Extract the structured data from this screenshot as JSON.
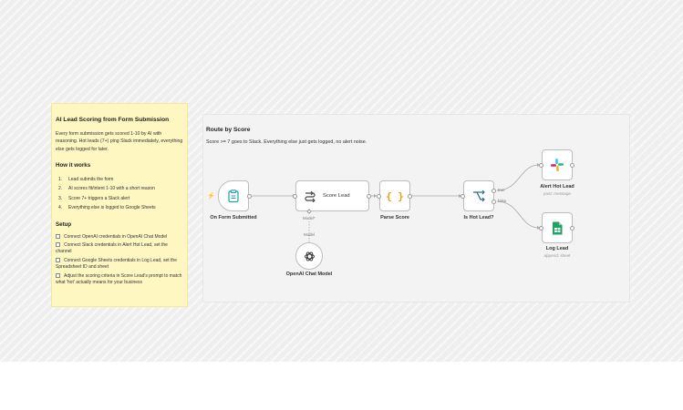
{
  "sticky": {
    "title": "AI Lead Scoring from Form Submission",
    "intro": "Every form submission gets scored 1-10 by AI with reasoning. Hot leads (7+) ping Slack immediately, everything else gets logged for later.",
    "how_heading": "How it works",
    "how_steps": [
      {
        "num": "1.",
        "text": "Lead submits the form"
      },
      {
        "num": "2.",
        "text": "AI scores fit/intent 1-10 with a short reason"
      },
      {
        "num": "3.",
        "text": "Score 7+ triggers a Slack alert"
      },
      {
        "num": "4.",
        "text": "Everything else is logged to Google Sheets"
      }
    ],
    "setup_heading": "Setup",
    "setup_items": [
      "Connect OpenAI credentials in OpenAI Chat Model",
      "Connect Slack credentials in Alert Hot Lead, set the channel",
      "Connect Google Sheets credentials in Log Lead, set the Spreadsheet ID and sheet",
      "Adjust the scoring criteria in Score Lead's prompt to match what 'hot' actually means for your business"
    ]
  },
  "group": {
    "title": "Route by Score",
    "description": "Score >= 7 goes to Slack. Everything else just gets logged, no alert noise."
  },
  "nodes": {
    "trigger": {
      "label": "On Form Submitted",
      "icon": "clipboard-icon"
    },
    "score": {
      "label": "Score Lead",
      "icon": "chain-icon",
      "port_model_label": "Model*"
    },
    "parse": {
      "label": "Parse Score",
      "icon": "braces-icon",
      "glyph": "{ }"
    },
    "if": {
      "label": "Is Hot Lead?",
      "icon": "branch-icon",
      "true_label": "true",
      "false_label": "false"
    },
    "alert": {
      "label": "Alert Hot Lead",
      "sub": "post: message",
      "icon": "slack-icon"
    },
    "log": {
      "label": "Log Lead",
      "sub": "append: sheet",
      "icon": "google-sheets-icon"
    },
    "openai": {
      "label": "OpenAI Chat Model",
      "icon": "openai-icon",
      "port_label": "Model"
    }
  },
  "colors": {
    "sticky_bg": "#fff7c2",
    "trigger_accent": "#ff6d3a",
    "slack_purple": "#4a154b",
    "sheets_green": "#1fa463"
  }
}
